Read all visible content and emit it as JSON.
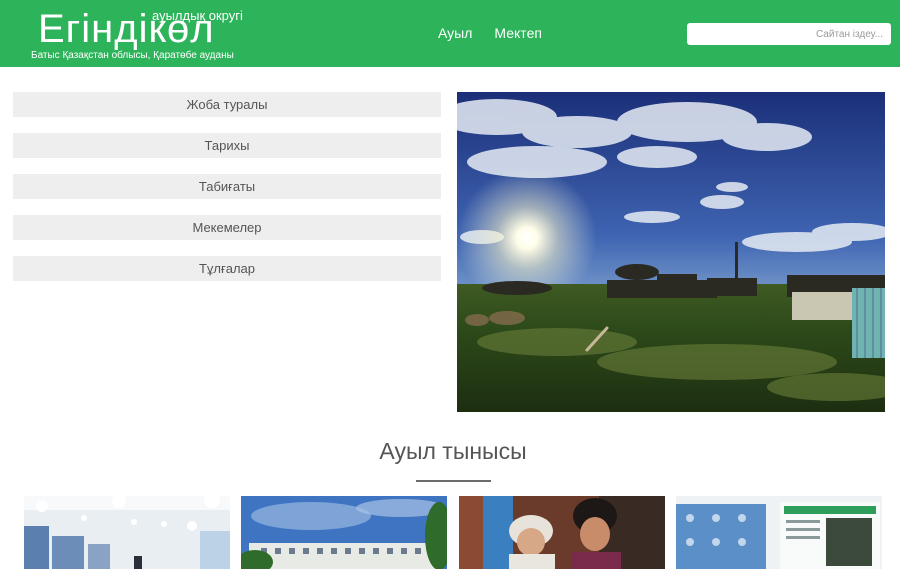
{
  "header": {
    "logo_title": "Егіндікөл",
    "logo_superscript": "ауылдық округі",
    "logo_subtitle": "Батыс Қазақстан облысы, Қаратөбе ауданы",
    "nav": [
      {
        "label": "Ауыл"
      },
      {
        "label": "Мектеп"
      }
    ],
    "search": {
      "placeholder": "Сайтан іздеу..."
    }
  },
  "sidebar": {
    "items": [
      {
        "label": "Жоба туралы"
      },
      {
        "label": "Тарихы"
      },
      {
        "label": "Табиғаты"
      },
      {
        "label": "Мекемелер"
      },
      {
        "label": "Тұлғалар"
      }
    ]
  },
  "main": {
    "section_title": "Ауыл тынысы"
  },
  "colors": {
    "brand_green": "#2db45a",
    "menu_bg": "#eeeeee",
    "text_gray": "#555555"
  }
}
